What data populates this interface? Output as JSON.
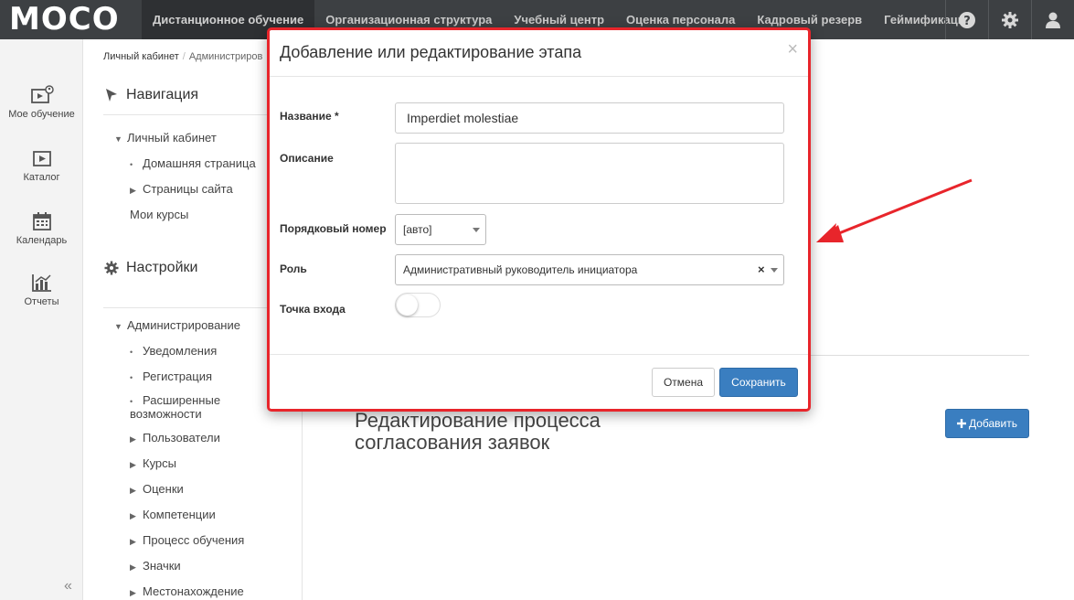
{
  "app": {
    "logo": "MOCO"
  },
  "topnav": {
    "items": [
      {
        "label": "Дистанционное обучение"
      },
      {
        "label": "Организационная структура"
      },
      {
        "label": "Учебный центр"
      },
      {
        "label": "Оценка персонала"
      },
      {
        "label": "Кадровый резерв"
      },
      {
        "label": "Геймификация"
      }
    ],
    "icons": [
      "help-icon",
      "gear-icon",
      "user-icon"
    ]
  },
  "leftbar": {
    "items": [
      {
        "label": "Мое обучение",
        "icon": "my-learning-icon"
      },
      {
        "label": "Каталог",
        "icon": "catalog-icon"
      },
      {
        "label": "Календарь",
        "icon": "calendar-icon"
      },
      {
        "label": "Отчеты",
        "icon": "reports-icon"
      }
    ],
    "collapse": "«"
  },
  "breadcrumb": {
    "items": [
      "Личный кабинет",
      "Администриров"
    ]
  },
  "sidebar": {
    "nav_title": "Навигация",
    "nav_items": [
      {
        "label": "Личный кабинет",
        "marker": "▼"
      },
      {
        "label": "Домашняя страница",
        "marker": "•"
      },
      {
        "label": "Страницы сайта",
        "marker": "▶"
      },
      {
        "label": "Мои курсы",
        "marker": ""
      }
    ],
    "settings_title": "Настройки",
    "settings_items": [
      {
        "label": "Администрирование",
        "marker": "▼"
      },
      {
        "label": "Уведомления",
        "marker": "•"
      },
      {
        "label": "Регистрация",
        "marker": "•"
      },
      {
        "label": "Расширенные",
        "label2": "возможности",
        "marker": "•"
      },
      {
        "label": "Пользователи",
        "marker": "▶"
      },
      {
        "label": "Курсы",
        "marker": "▶"
      },
      {
        "label": "Оценки",
        "marker": "▶"
      },
      {
        "label": "Компетенции",
        "marker": "▶"
      },
      {
        "label": "Процесс обучения",
        "marker": "▶"
      },
      {
        "label": "Значки",
        "marker": "▶"
      },
      {
        "label": "Местонахождение",
        "marker": "▶"
      }
    ]
  },
  "main": {
    "title_line1": "Редактирование процесса",
    "title_line2": "согласования заявок",
    "add_button": "Добавить"
  },
  "modal": {
    "title": "Добавление или редактирование этапа",
    "close": "×",
    "name_label": "Название *",
    "name_value": "Imperdiet molestiae",
    "description_label": "Описание",
    "description_value": "",
    "order_label": "Порядковый номер",
    "order_value": "[авто]",
    "role_label": "Роль",
    "role_value": "Административный руководитель инициатора",
    "role_clear": "×",
    "entry_label": "Точка входа",
    "entry_on": false,
    "cancel": "Отмена",
    "save": "Сохранить"
  },
  "colors": {
    "accent": "#3a7ec0",
    "topbar": "#3d4043",
    "highlight": "#e8252b"
  }
}
